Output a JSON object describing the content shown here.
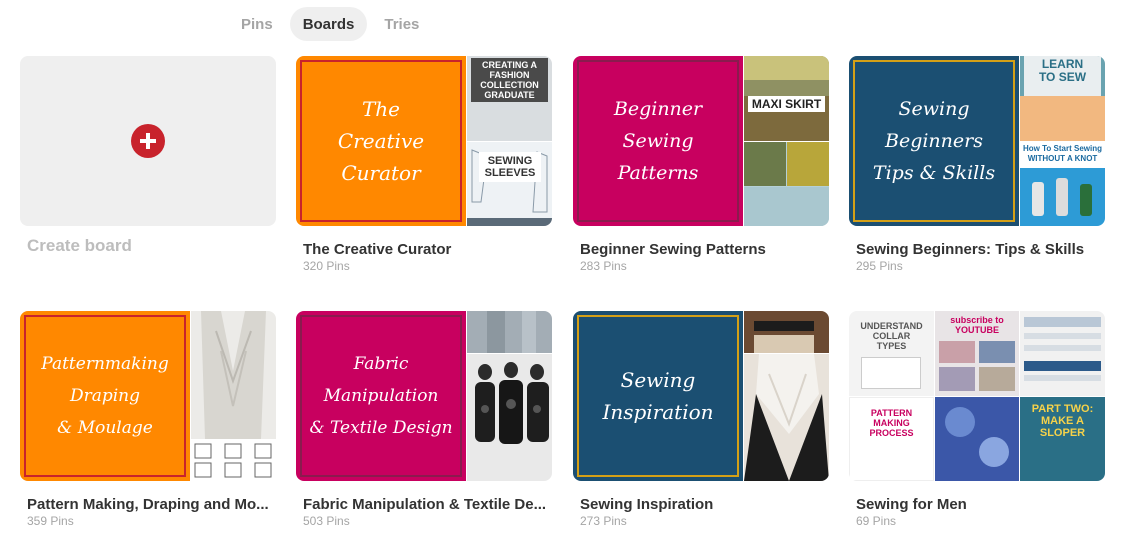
{
  "tabs": [
    {
      "label": "Pins"
    },
    {
      "label": "Boards"
    },
    {
      "label": "Tries"
    }
  ],
  "create_board": {
    "label": "Create board"
  },
  "boards": [
    {
      "title": "The Creative Curator",
      "count": "320 Pins",
      "cover_text": "The\nCreative\nCurator",
      "colors": {
        "cover": "#ff8800",
        "border": "#c8232c"
      },
      "side_top_text": "CREATING A\nFASHION\nCOLLECTION\nGRADUATE",
      "side_bottom_text": "SEWING\nSLEEVES"
    },
    {
      "title": "Beginner Sewing Patterns",
      "count": "283 Pins",
      "cover_text": "Beginner\nSewing\nPatterns",
      "colors": {
        "cover": "#c8005f",
        "border": "#8a1b4e"
      },
      "side_top_text": "MAXI SKIRT",
      "side_bottom_text": ""
    },
    {
      "title": "Sewing Beginners: Tips & Skills",
      "count": "295 Pins",
      "cover_text": "Sewing\nBeginners\nTips & Skills",
      "colors": {
        "cover": "#1b4f72",
        "border": "#d4a017"
      },
      "side_top_text": "LEARN\nTO SEW",
      "side_bottom_text": "How To Start Sewing\nWITHOUT A KNOT"
    },
    {
      "title": "Pattern Making, Draping and Mo...",
      "count": "359 Pins",
      "cover_text": "Patternmaking\nDraping\n& Moulage",
      "colors": {
        "cover": "#ff8800",
        "border": "#c8232c"
      },
      "side_top_text": "",
      "side_bottom_text": ""
    },
    {
      "title": "Fabric Manipulation & Textile De...",
      "count": "503 Pins",
      "cover_text": "Fabric\nManipulation\n& Textile Design",
      "colors": {
        "cover": "#c8005f",
        "border": "#8a1b4e"
      },
      "side_top_text": "",
      "side_bottom_text": ""
    },
    {
      "title": "Sewing Inspiration",
      "count": "273 Pins",
      "cover_text": "Sewing\nInspiration",
      "colors": {
        "cover": "#1b4f72",
        "border": "#d4a017"
      },
      "side_top_text": "",
      "side_bottom_text": ""
    },
    {
      "title": "Sewing for Men",
      "count": "69 Pins",
      "cover_text": "",
      "colors": {
        "cover": "#f3f3f3",
        "border": "#f3f3f3"
      },
      "side_top_text": "subscribe to\nYOUTUBE",
      "side_bottom_text": "PART TWO:\nMAKE A\nSLOPER"
    }
  ],
  "men_board_text": {
    "collar": "UNDERSTAND\nCOLLAR\nTYPES",
    "process": "PATTERN\nMAKING\nPROCESS"
  },
  "colors": {
    "accent_red": "#c8232c",
    "text_muted": "#a5a5a5",
    "tab_active_bg": "#efefef"
  }
}
